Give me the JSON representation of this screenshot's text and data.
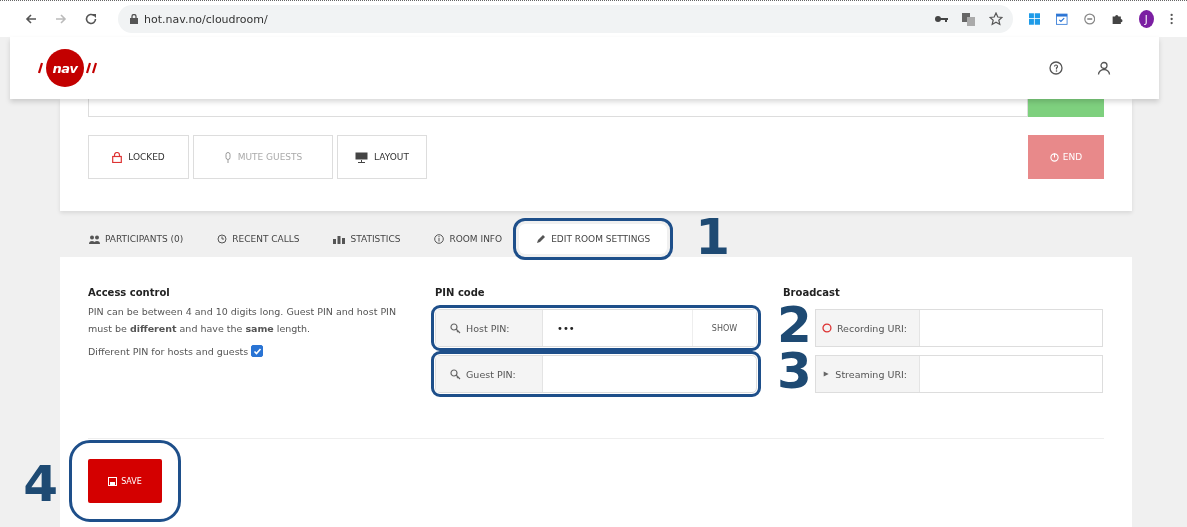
{
  "browser": {
    "url": "hot.nav.no/cloudroom/",
    "profile_initial": "J"
  },
  "header": {
    "logo_text": "nav"
  },
  "room_controls": {
    "buttons": [
      {
        "label": "LOCKED",
        "kind": "lock",
        "disabled": false
      },
      {
        "label": "MUTE GUESTS",
        "kind": "mic",
        "disabled": true
      },
      {
        "label": "LAYOUT",
        "kind": "layout",
        "disabled": false
      }
    ],
    "end_button": "END"
  },
  "tabs": [
    {
      "label": "PARTICIPANTS (0)",
      "kind": "people",
      "selected": false
    },
    {
      "label": "RECENT CALLS",
      "kind": "history",
      "selected": false
    },
    {
      "label": "STATISTICS",
      "kind": "chart",
      "selected": false
    },
    {
      "label": "ROOM INFO",
      "kind": "info",
      "selected": false
    },
    {
      "label": "EDIT ROOM SETTINGS",
      "kind": "pencil",
      "selected": true,
      "callout": "1"
    }
  ],
  "access_control": {
    "heading": "Access control",
    "description": "PIN can be between 4 and 10 digits long. Guest PIN and host PIN must be **different** and have the **same** length.",
    "checkbox": {
      "label": "Different PIN for hosts and guests",
      "checked": true
    }
  },
  "pin_code": {
    "heading": "PIN code",
    "fields": [
      {
        "label": "Host PIN:",
        "value": "•••",
        "show_button": "SHOW",
        "callout": "2"
      },
      {
        "label": "Guest PIN:",
        "callout": "3"
      }
    ]
  },
  "broadcast": {
    "heading": "Broadcast",
    "fields": [
      {
        "label": "Recording URI:",
        "kind": "recording"
      },
      {
        "label": "Streaming URI:",
        "kind": "streaming"
      }
    ]
  },
  "save": {
    "label": "SAVE",
    "callout": "4"
  }
}
